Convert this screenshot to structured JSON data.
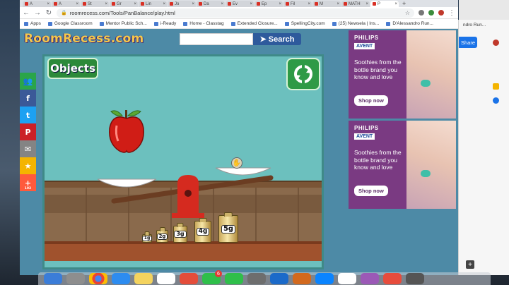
{
  "browser": {
    "tabs": [
      {
        "label": "A"
      },
      {
        "label": "A"
      },
      {
        "label": "St"
      },
      {
        "label": "Gr"
      },
      {
        "label": "Lin"
      },
      {
        "label": "Jo"
      },
      {
        "label": "Da"
      },
      {
        "label": "Ev"
      },
      {
        "label": "Ep"
      },
      {
        "label": "Fil"
      },
      {
        "label": "M"
      },
      {
        "label": "MATH"
      },
      {
        "label": "P"
      }
    ],
    "new_tab_label": "+",
    "url": "roomrecess.com/Tools/PanBalance/play.html",
    "bookmarks": [
      {
        "label": "Apps",
        "icon": "apps-grid-icon"
      },
      {
        "label": "Google Classroom",
        "icon": "classroom-icon"
      },
      {
        "label": "Mentor Public Sch...",
        "icon": "school-icon"
      },
      {
        "label": "i-Ready",
        "icon": "iready-icon"
      },
      {
        "label": "Home - Classtag",
        "icon": "classtag-icon"
      },
      {
        "label": "Extended Closure...",
        "icon": "doc-icon"
      },
      {
        "label": "SpellingCity.com",
        "icon": "spellingcity-icon"
      },
      {
        "label": "(25) Newsela | Ins...",
        "icon": "newsela-icon"
      },
      {
        "label": "D'Alessandro Run...",
        "icon": "profile-icon"
      }
    ]
  },
  "site": {
    "logo_text": "RoomRecess.com",
    "search_label": "Search",
    "search_placeholder": ""
  },
  "share_bar": [
    {
      "name": "share-count-button",
      "glyph": "👥",
      "color": "#2aa54a"
    },
    {
      "name": "facebook-button",
      "glyph": "f",
      "color": "#3b5998"
    },
    {
      "name": "twitter-button",
      "glyph": "t",
      "color": "#1da1f2"
    },
    {
      "name": "pinterest-button",
      "glyph": "P",
      "color": "#cb2027"
    },
    {
      "name": "email-button",
      "glyph": "✉",
      "color": "#848484"
    },
    {
      "name": "favorite-button",
      "glyph": "★",
      "color": "#f4b400"
    },
    {
      "name": "more-share-button",
      "glyph": "+",
      "color": "#ff5a3c",
      "count": "102"
    }
  ],
  "game": {
    "objects_label": "Objects",
    "weights": [
      {
        "label": "1g"
      },
      {
        "label": "2g"
      },
      {
        "label": "3g"
      },
      {
        "label": "4g"
      },
      {
        "label": "5g"
      }
    ]
  },
  "ads": [
    {
      "brand": "PHILIPS",
      "sub_brand": "AVENT",
      "copy": "Soothies from the bottle brand you know and love",
      "cta": "Shop now"
    },
    {
      "brand": "PHILIPS",
      "sub_brand": "AVENT",
      "copy": "Soothies from the bottle brand you know and love",
      "cta": "Shop now"
    }
  ],
  "background_window": {
    "header_text": "ndro Run...",
    "share_label": "Share"
  },
  "colors": {
    "accent_blue": "#1a73e8",
    "site_bg": "#4d8aa6",
    "game_bg": "#6cc0be"
  }
}
